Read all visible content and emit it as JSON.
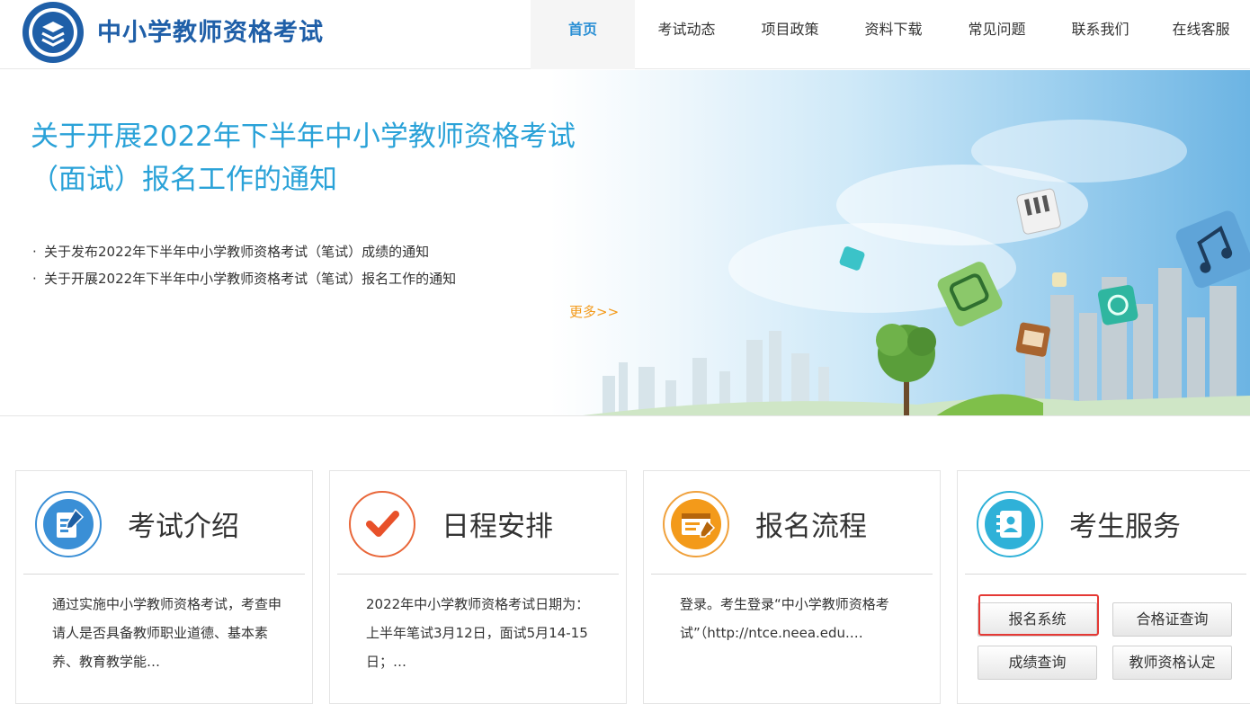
{
  "header": {
    "site_title": "中小学教师资格考试",
    "nav": [
      {
        "label": "首页",
        "active": true
      },
      {
        "label": "考试动态"
      },
      {
        "label": "项目政策"
      },
      {
        "label": "资料下载"
      },
      {
        "label": "常见问题"
      },
      {
        "label": "联系我们"
      },
      {
        "label": "在线客服"
      }
    ]
  },
  "banner": {
    "headline": "关于开展2022年下半年中小学教师资格考试（面试）报名工作的通知",
    "news": [
      "关于发布2022年下半年中小学教师资格考试（笔试）成绩的通知",
      "关于开展2022年下半年中小学教师资格考试（笔试）报名工作的通知"
    ],
    "bullet": "·",
    "more": "更多>>"
  },
  "cards": [
    {
      "title": "考试介绍",
      "icon": "document-edit-icon",
      "text": "通过实施中小学教师资格考试，考查申请人是否具备教师职业道德、基本素养、教育教学能…"
    },
    {
      "title": "日程安排",
      "icon": "checkmark-icon",
      "text": "2022年中小学教师资格考试日期为：上半年笔试3月12日，面试5月14-15日；…"
    },
    {
      "title": "报名流程",
      "icon": "form-window-icon",
      "text": "登录。考生登录“中小学教师资格考试”（http://ntce.neea.edu.…"
    },
    {
      "title": "考生服务",
      "icon": "contact-book-icon"
    }
  ],
  "services": {
    "register": "报名系统",
    "certificate": "合格证查询",
    "scores": "成绩查询",
    "qualification": "教师资格认定"
  },
  "colors": {
    "brand_blue": "#1f5fa8",
    "accent_blue": "#2aa2d8",
    "orange": "#f39a1a",
    "highlight_red": "#e53935"
  }
}
